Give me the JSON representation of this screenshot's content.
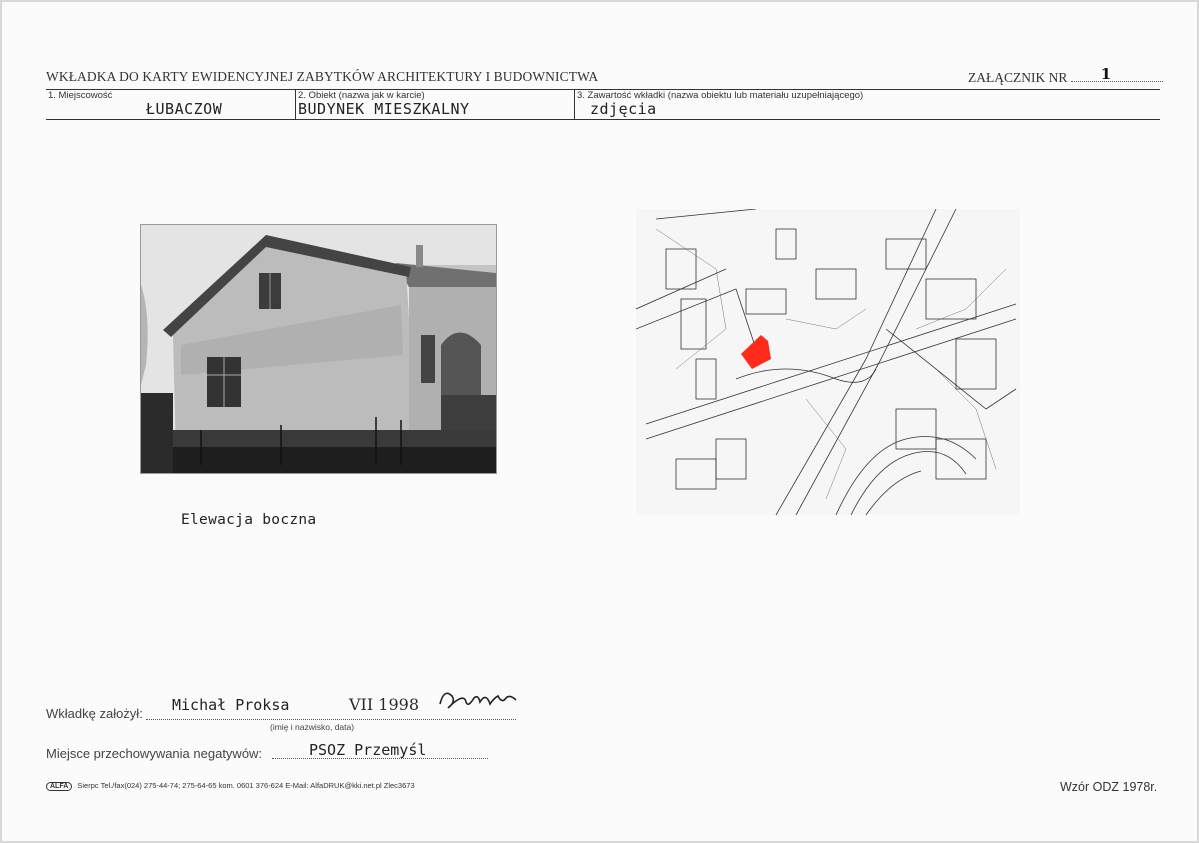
{
  "header": {
    "title": "WKŁADKA DO KARTY EWIDENCYJNEJ ZABYTKÓW ARCHITEKTURY I BUDOWNICTWA",
    "zalacznik_label": "ZAŁĄCZNIK NR",
    "zalacznik_value": "1"
  },
  "fields": {
    "miejscowosc_label": "1. Miejscowość",
    "miejscowosc_value": "ŁUBACZOW",
    "obiekt_label": "2. Obiekt (nazwa jak w karcie)",
    "obiekt_value": "BUDYNEK MIESZKALNY",
    "zawartosc_label": "3. Zawartość wkładki (nazwa obiektu lub materiału uzupełniającego)",
    "zawartosc_value": "zdjęcia"
  },
  "caption": "Elewacja boczna",
  "footer": {
    "zalozyl_label": "Wkładkę założył:",
    "zalozyl_value": "Michał Proksa",
    "zalozyl_date": "VII 1998",
    "zalozyl_hint": "(imię i nazwisko, data)",
    "negatywy_label": "Miejsce przechowywania negatywów:",
    "negatywy_value": "PSOZ Przemyśl",
    "printer_logo": "ALFA",
    "printer_info": "Sierpc Tel./fax(024) 275-44-74; 275-64-65 kom. 0601 376-624   E-Mail: AlfaDRUK@kki.net.pl   Zlec3673",
    "wzor": "Wzór ODZ 1978r."
  },
  "colors": {
    "map_highlight": "#ff2a1a",
    "ink": "#2a2a2a"
  }
}
